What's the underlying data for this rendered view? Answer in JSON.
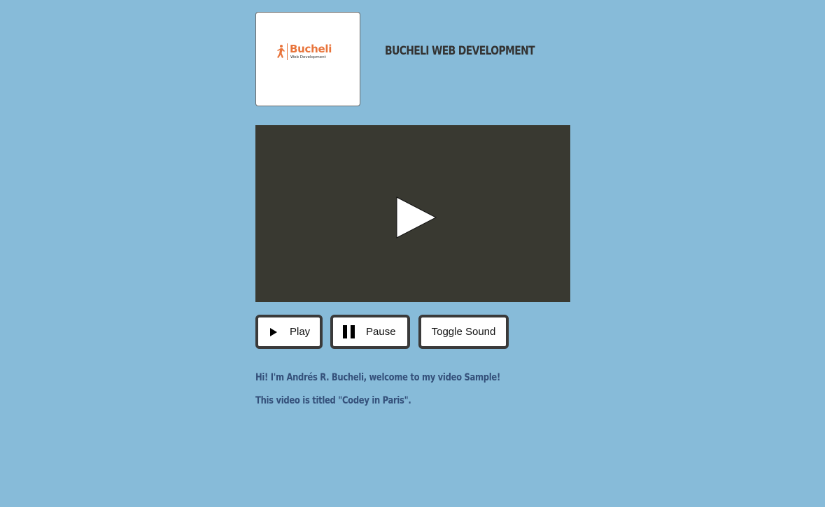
{
  "header": {
    "logo": {
      "name": "Bucheli",
      "subtitle": "Web Development",
      "accent_color": "#e8743b"
    },
    "title": "BUCHELI WEB DEVELOPMENT"
  },
  "video": {
    "state": "paused",
    "overlay_icon": "play-icon",
    "background_color": "#393931"
  },
  "controls": {
    "play_label": "Play",
    "pause_label": "Pause",
    "sound_label": "Toggle Sound"
  },
  "intro": {
    "line1": "Hi! I'm Andrés R. Bucheli, welcome to my video Sample!",
    "line2": "This video is titled \"Codey in Paris\"."
  },
  "colors": {
    "page_background": "#87bbd9",
    "title": "#333333",
    "intro_text": "#34507a"
  }
}
